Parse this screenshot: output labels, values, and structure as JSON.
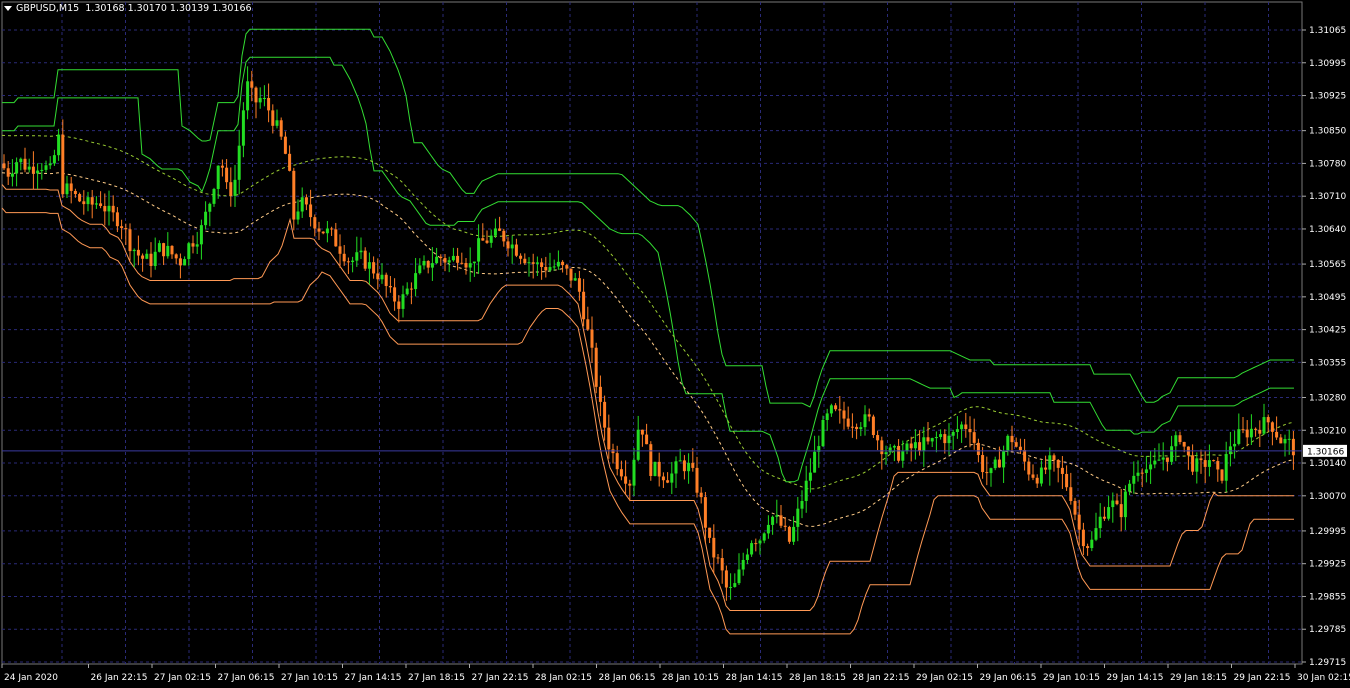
{
  "header": {
    "symbol": "GBPUSD,M15",
    "open": "1.30168",
    "high": "1.30170",
    "low": "1.30139",
    "close": "1.30166"
  },
  "current_price": "1.30166",
  "colors": {
    "background": "#000000",
    "grid": "#2a2a78",
    "bull_candle": "#22dd22",
    "bear_candle": "#ff7f27",
    "upper_band": "#33dd33",
    "lower_band": "#ff9955",
    "axis_text": "#ffffff",
    "price_line": "#3a3aa0"
  },
  "chart_data": {
    "type": "candlestick",
    "symbol": "GBPUSD",
    "timeframe": "M15",
    "y_ticks": [
      "1.31065",
      "1.30995",
      "1.30925",
      "1.30850",
      "1.30780",
      "1.30710",
      "1.30640",
      "1.30565",
      "1.30495",
      "1.30425",
      "1.30355",
      "1.30280",
      "1.30210",
      "1.30140",
      "1.30070",
      "1.29995",
      "1.29925",
      "1.29855",
      "1.29785",
      "1.29715"
    ],
    "ylim": [
      1.29715,
      1.31065
    ],
    "x_ticks": [
      "24 Jan 2020",
      "26 Jan 22:15",
      "27 Jan 02:15",
      "27 Jan 06:15",
      "27 Jan 10:15",
      "27 Jan 14:15",
      "27 Jan 18:15",
      "27 Jan 22:15",
      "28 Jan 02:15",
      "28 Jan 06:15",
      "28 Jan 10:15",
      "28 Jan 14:15",
      "28 Jan 18:15",
      "28 Jan 22:15",
      "29 Jan 02:15",
      "29 Jan 06:15",
      "29 Jan 10:15",
      "29 Jan 14:15",
      "29 Jan 18:15",
      "29 Jan 22:15",
      "30 Jan 02:15"
    ],
    "price_path": [
      [
        0,
        1.3078
      ],
      [
        8,
        1.3076
      ],
      [
        18,
        1.3079
      ],
      [
        28,
        1.3077
      ],
      [
        40,
        1.3078
      ],
      [
        52,
        1.3076
      ],
      [
        58,
        1.3085
      ],
      [
        62,
        1.3073
      ],
      [
        70,
        1.3072
      ],
      [
        80,
        1.307
      ],
      [
        90,
        1.3069
      ],
      [
        100,
        1.307
      ],
      [
        110,
        1.3067
      ],
      [
        120,
        1.3066
      ],
      [
        130,
        1.3061
      ],
      [
        140,
        1.3058
      ],
      [
        150,
        1.3057
      ],
      [
        160,
        1.306
      ],
      [
        170,
        1.3059
      ],
      [
        180,
        1.3057
      ],
      [
        190,
        1.3061
      ],
      [
        200,
        1.3063
      ],
      [
        210,
        1.307
      ],
      [
        220,
        1.308
      ],
      [
        228,
        1.3071
      ],
      [
        236,
        1.3075
      ],
      [
        242,
        1.3088
      ],
      [
        248,
        1.3095
      ],
      [
        254,
        1.3091
      ],
      [
        262,
        1.3092
      ],
      [
        270,
        1.3089
      ],
      [
        280,
        1.3084
      ],
      [
        288,
        1.3078
      ],
      [
        294,
        1.3066
      ],
      [
        300,
        1.307
      ],
      [
        310,
        1.3067
      ],
      [
        320,
        1.3064
      ],
      [
        330,
        1.3063
      ],
      [
        340,
        1.306
      ],
      [
        350,
        1.3057
      ],
      [
        360,
        1.3058
      ],
      [
        370,
        1.3056
      ],
      [
        380,
        1.3054
      ],
      [
        390,
        1.305
      ],
      [
        400,
        1.3048
      ],
      [
        410,
        1.3052
      ],
      [
        420,
        1.3055
      ],
      [
        430,
        1.3057
      ],
      [
        440,
        1.3058
      ],
      [
        450,
        1.3057
      ],
      [
        460,
        1.3059
      ],
      [
        470,
        1.3056
      ],
      [
        480,
        1.3061
      ],
      [
        490,
        1.3062
      ],
      [
        500,
        1.3063
      ],
      [
        510,
        1.3061
      ],
      [
        520,
        1.3059
      ],
      [
        530,
        1.3057
      ],
      [
        540,
        1.3056
      ],
      [
        550,
        1.3056
      ],
      [
        560,
        1.3056
      ],
      [
        570,
        1.3054
      ],
      [
        578,
        1.3052
      ],
      [
        585,
        1.3045
      ],
      [
        592,
        1.3037
      ],
      [
        600,
        1.3026
      ],
      [
        610,
        1.3017
      ],
      [
        620,
        1.3013
      ],
      [
        630,
        1.301
      ],
      [
        640,
        1.3024
      ],
      [
        650,
        1.3013
      ],
      [
        660,
        1.3012
      ],
      [
        670,
        1.3011
      ],
      [
        680,
        1.3014
      ],
      [
        690,
        1.3013
      ],
      [
        700,
        1.3007
      ],
      [
        710,
        1.2996
      ],
      [
        720,
        1.2992
      ],
      [
        728,
        1.2986
      ],
      [
        736,
        1.2988
      ],
      [
        744,
        1.2994
      ],
      [
        752,
        1.2998
      ],
      [
        760,
        1.2998
      ],
      [
        770,
        1.3003
      ],
      [
        780,
        1.3001
      ],
      [
        790,
        1.2997
      ],
      [
        800,
        1.3005
      ],
      [
        810,
        1.3012
      ],
      [
        820,
        1.302
      ],
      [
        830,
        1.3025
      ],
      [
        840,
        1.3024
      ],
      [
        850,
        1.3023
      ],
      [
        860,
        1.3023
      ],
      [
        870,
        1.3023
      ],
      [
        880,
        1.3018
      ],
      [
        890,
        1.3016
      ],
      [
        900,
        1.3016
      ],
      [
        910,
        1.3017
      ],
      [
        920,
        1.3018
      ],
      [
        930,
        1.3018
      ],
      [
        940,
        1.302
      ],
      [
        950,
        1.3019
      ],
      [
        960,
        1.3022
      ],
      [
        970,
        1.3022
      ],
      [
        980,
        1.3014
      ],
      [
        990,
        1.3011
      ],
      [
        1000,
        1.3015
      ],
      [
        1010,
        1.302
      ],
      [
        1020,
        1.3016
      ],
      [
        1030,
        1.3012
      ],
      [
        1040,
        1.3011
      ],
      [
        1050,
        1.3014
      ],
      [
        1060,
        1.3012
      ],
      [
        1070,
        1.3008
      ],
      [
        1080,
        1.2999
      ],
      [
        1090,
        1.2996
      ],
      [
        1100,
        1.3002
      ],
      [
        1110,
        1.3006
      ],
      [
        1120,
        1.3003
      ],
      [
        1130,
        1.301
      ],
      [
        1140,
        1.3014
      ],
      [
        1150,
        1.3012
      ],
      [
        1160,
        1.3015
      ],
      [
        1170,
        1.3016
      ],
      [
        1180,
        1.302
      ],
      [
        1190,
        1.3014
      ],
      [
        1200,
        1.3013
      ],
      [
        1210,
        1.3015
      ],
      [
        1220,
        1.301
      ],
      [
        1230,
        1.3018
      ],
      [
        1240,
        1.302
      ],
      [
        1250,
        1.3021
      ],
      [
        1260,
        1.3022
      ],
      [
        1270,
        1.3023
      ],
      [
        1280,
        1.3019
      ],
      [
        1290,
        1.3018
      ],
      [
        1295,
        1.30166
      ]
    ],
    "grid": true
  }
}
